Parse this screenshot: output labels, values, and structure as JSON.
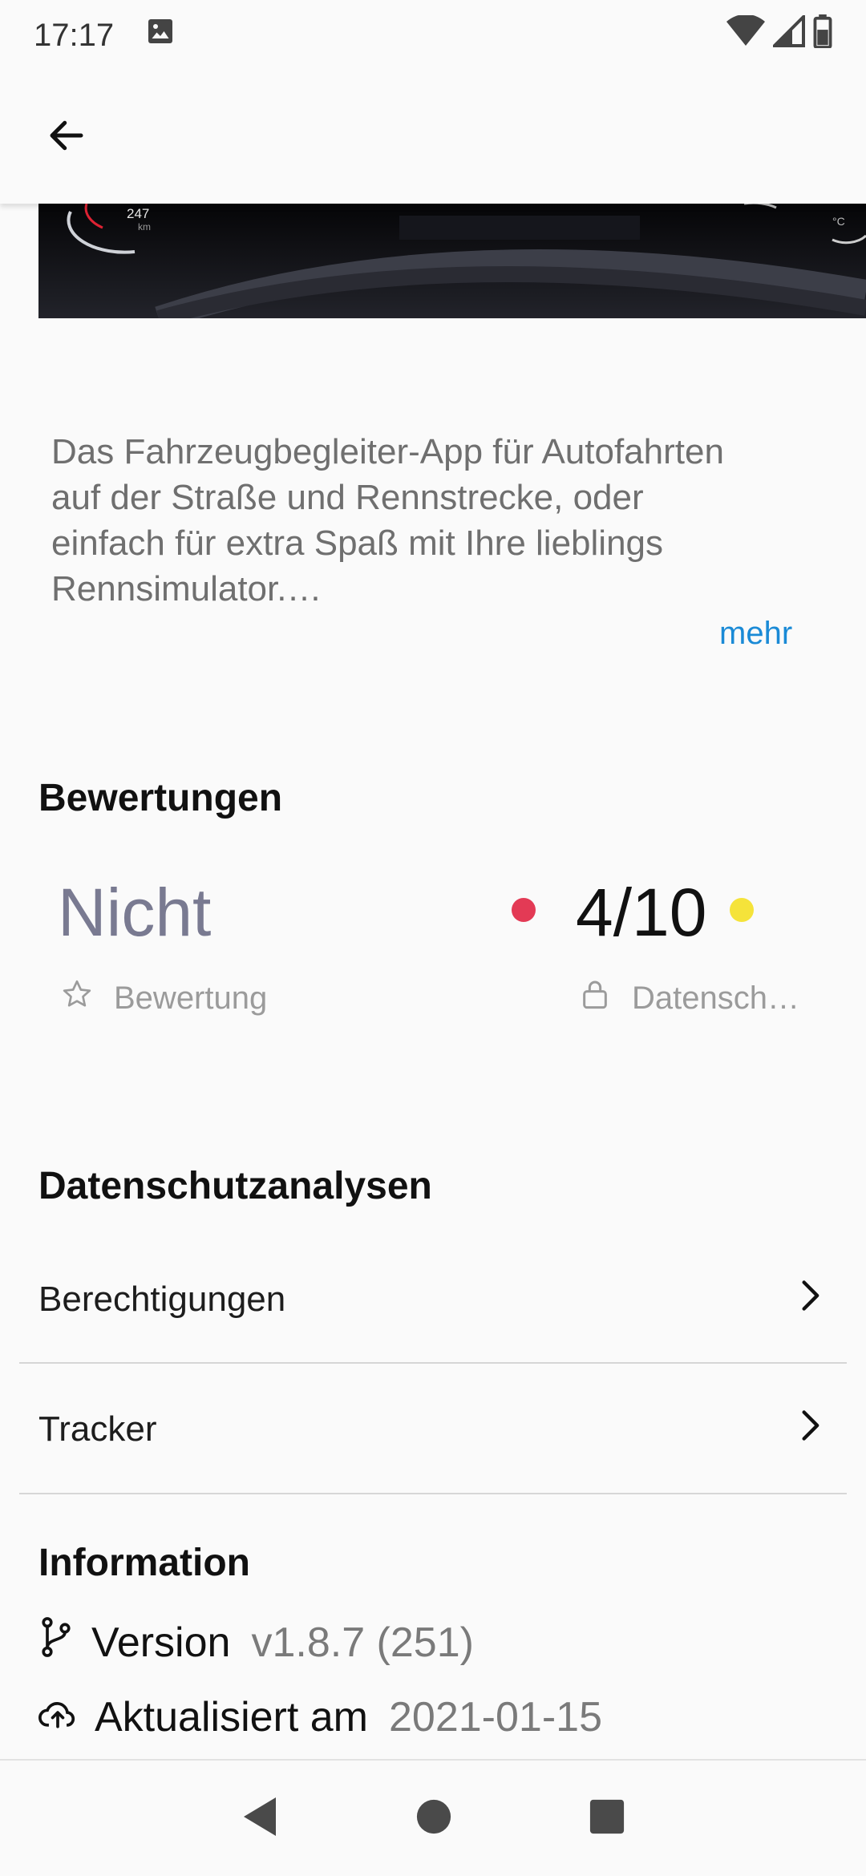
{
  "status_bar": {
    "time": "17:17",
    "icons": [
      "image-icon",
      "wifi-icon",
      "signal-icon",
      "battery-icon"
    ]
  },
  "app_bar": {
    "back_icon": "arrow-left-icon"
  },
  "banner": {
    "speed_value": "247",
    "speed_unit": "km",
    "temp_unit": "°C"
  },
  "description": {
    "lines": [
      "Das Fahrzeugbegleiter-App für Autofahrten",
      "auf der Straße und Rennstrecke, oder",
      "einfach für extra Spaß mit Ihre lieblings",
      "Rennsimulator.…"
    ],
    "more_label": "mehr"
  },
  "ratings": {
    "title": "Bewertungen",
    "score_value": "Nicht",
    "score_caption": "Bewertung",
    "privacy_value": "4/10",
    "privacy_caption": "Datensch…",
    "colors": {
      "red_dot": "#e33a55",
      "yellow_dot": "#f5e33a",
      "muted_value": "#797a91"
    }
  },
  "privacy": {
    "title": "Datenschutzanalysen",
    "items": [
      {
        "label": "Berechtigungen"
      },
      {
        "label": "Tracker"
      }
    ]
  },
  "information": {
    "title": "Information",
    "version_label": "Version",
    "version_value": "v1.8.7 (251)",
    "updated_label": "Aktualisiert am",
    "updated_value": "2021-01-15"
  },
  "nav_bar": {
    "icons": [
      "back-triangle-icon",
      "home-circle-icon",
      "recents-square-icon"
    ]
  }
}
